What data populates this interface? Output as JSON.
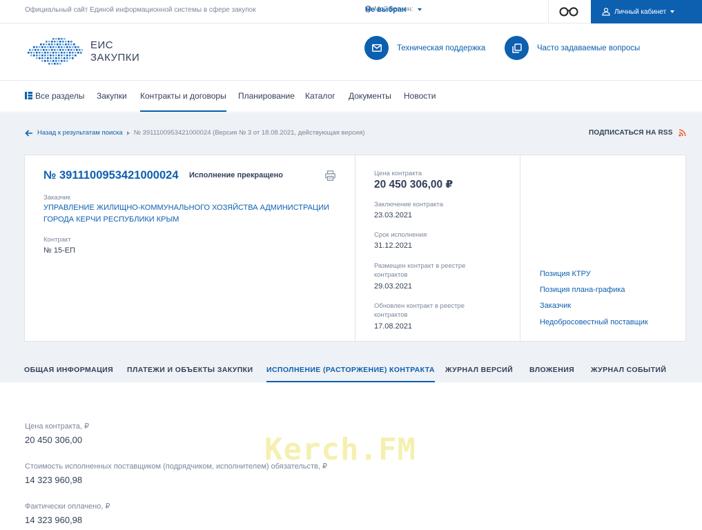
{
  "topbar": {
    "site_description": "Официальный сайт Единой информационной системы в сфере закупок",
    "region_label": "Мой регион:",
    "region_value": "Не выбран",
    "cabinet_label": "Личный кабинет"
  },
  "header": {
    "logo_line1": "ЕИС",
    "logo_line2": "ЗАКУПКИ",
    "support_label": "Техническая поддержка",
    "faq_label": "Часто задаваемые вопросы"
  },
  "nav": {
    "items": [
      "Все разделы",
      "Закупки",
      "Контракты и договоры",
      "Планирование",
      "Каталог",
      "Документы",
      "Новости"
    ],
    "active_index": 2
  },
  "breadcrumbs": {
    "back": "Назад к результатам поиска",
    "current": "№ 3911100953421000024 (Версия № 3 от 18.08.2021, действующая версия)",
    "rss": "ПОДПИСАТЬСЯ НА RSS"
  },
  "contract": {
    "number": "№ 3911100953421000024",
    "status": "Исполнение прекращено",
    "customer_label": "Заказчик",
    "customer_line1": "УПРАВЛЕНИЕ ЖИЛИЩНО-КОММУНАЛЬНОГО ХОЗЯЙСТВА АДМИНИСТРАЦИИ",
    "customer_line2": "ГОРОДА КЕРЧИ РЕСПУБЛИКИ КРЫМ",
    "contract_label": "Контракт",
    "contract_value": "№ 15-ЕП",
    "price_label": "Цена контракта",
    "price_value": "20 450 306,00 ₽",
    "conclusion_label": "Заключение контракта",
    "conclusion_value": "23.03.2021",
    "term_label": "Срок исполнения",
    "term_value": "31.12.2021",
    "placed_label_1": "Размещен контракт в реестре",
    "placed_label_2": "контрактов",
    "placed_value": "29.03.2021",
    "updated_label_1": "Обновлен контракт в реестре",
    "updated_label_2": "контрактов",
    "updated_value": "17.08.2021",
    "links": [
      "Позиция КТРУ",
      "Позиция плана-графика",
      "Заказчик",
      "Недобросовестный поставщик"
    ]
  },
  "tabs": {
    "items": [
      "ОБЩАЯ ИНФОРМАЦИЯ",
      "ПЛАТЕЖИ И ОБЪЕКТЫ ЗАКУПКИ",
      "ИСПОЛНЕНИЕ (РАСТОРЖЕНИЕ) КОНТРАКТА",
      "ЖУРНАЛ ВЕРСИЙ",
      "ВЛОЖЕНИЯ",
      "ЖУРНАЛ СОБЫТИЙ"
    ],
    "active_index": 2
  },
  "execution": [
    {
      "label": "Цена контракта, ₽",
      "value": "20 450 306,00"
    },
    {
      "label": "Стоимость исполненных поставщиком (подрядчиком, исполнителем) обязательств, ₽",
      "value": "14 323 960,98"
    },
    {
      "label": "Фактически оплачено, ₽",
      "value": "14 323 960,98"
    }
  ],
  "watermark": "Kerch.FM",
  "colors": {
    "accent": "#0d5fb0",
    "text": "#334059",
    "muted": "#7a869c",
    "rss": "#e8622c"
  }
}
